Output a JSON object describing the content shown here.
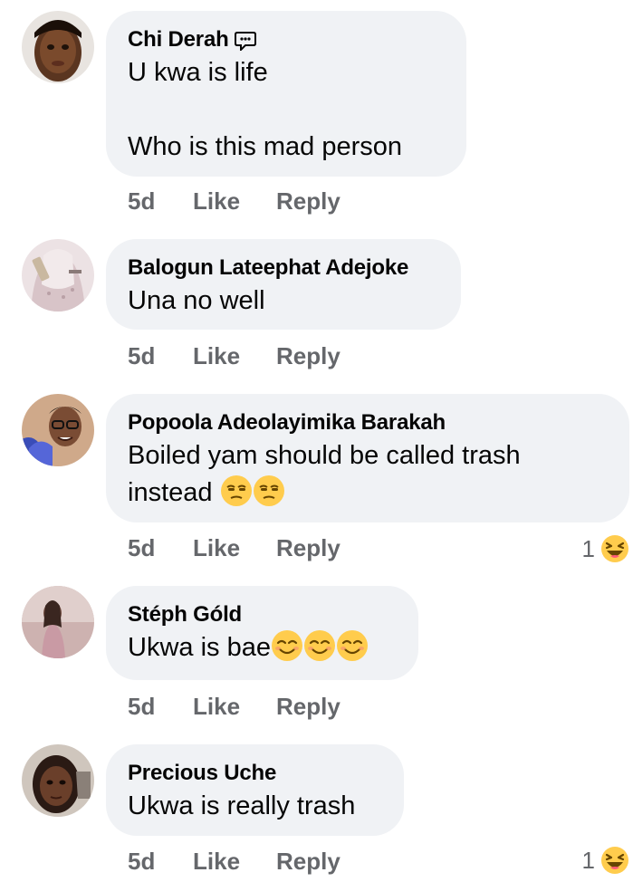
{
  "comments": [
    {
      "author": "Chi Derah",
      "text": "U kwa is life\n\nWho is this mad person",
      "time": "5d",
      "like_label": "Like",
      "reply_label": "Reply",
      "author_icon": "chat-bubble-icon",
      "avatar_color": "#6b4226"
    },
    {
      "author": "Balogun Lateephat Adejoke",
      "text": "Una no well",
      "time": "5d",
      "like_label": "Like",
      "reply_label": "Reply",
      "avatar_color": "#d9c6c8"
    },
    {
      "author": "Popoola Adeolayimika Barakah",
      "text": "Boiled yam should be called trash instead",
      "emojis": [
        "unamused-face",
        "unamused-face"
      ],
      "time": "5d",
      "like_label": "Like",
      "reply_label": "Reply",
      "reaction_count": "1",
      "reaction_icon": "laughing-face",
      "avatar_color": "#7d5c4a"
    },
    {
      "author": "Stéph Góld",
      "text": "Ukwa is bae",
      "emojis": [
        "smirking-face",
        "smirking-face",
        "smirking-face"
      ],
      "time": "5d",
      "like_label": "Like",
      "reply_label": "Reply",
      "avatar_color": "#b08a8e"
    },
    {
      "author": "Precious Uche",
      "text": "Ukwa is really trash",
      "time": "5d",
      "like_label": "Like",
      "reply_label": "Reply",
      "reaction_count": "1",
      "reaction_icon": "laughing-face",
      "avatar_color": "#3a2a22"
    }
  ],
  "colors": {
    "bubble": "#f0f2f5",
    "text": "#050505",
    "secondary": "#65676b",
    "emoji_yellow": "#ffcc4d"
  }
}
